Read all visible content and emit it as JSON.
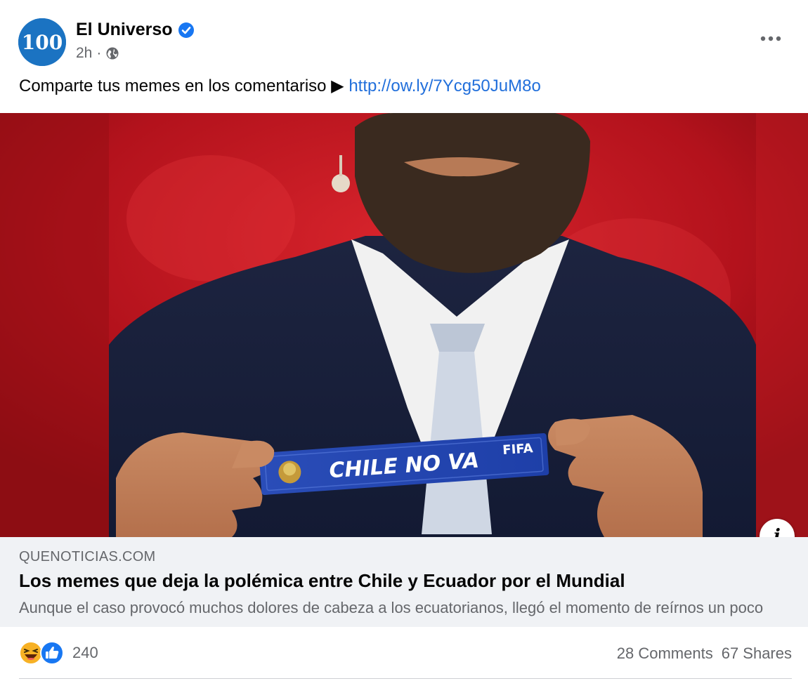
{
  "post": {
    "page_name": "El Universo",
    "avatar_text": "100",
    "time": "2h",
    "meta_separator": "·",
    "caption_text": "Comparte tus memes en los comentariso ▶ ",
    "caption_link": "http://ow.ly/7Ycg50JuM8o",
    "image": {
      "banner_text": "CHILE NO VA",
      "fifa_text": "FIFA"
    },
    "link_preview": {
      "domain": "QUENOTICIAS.COM",
      "title": "Los memes que deja la polémica entre Chile y Ecuador por el Mundial",
      "description": "Aunque el caso provocó muchos dolores de cabeza a los ecuatorianos, llegó el momento de reírnos un poco"
    },
    "info_icon": "i",
    "reaction_count": "240",
    "comments": "28 Comments",
    "shares": "67 Shares"
  },
  "colors": {
    "link": "#216fdb",
    "verified": "#1877f2",
    "brand_avatar": "#1b73c2",
    "secondary_text": "#65676b",
    "preview_bg": "#f0f2f5",
    "banner_blue": "#1e3fa8",
    "backdrop_red": "#b3121c"
  },
  "icons": [
    "verified-badge-icon",
    "globe-icon",
    "more-options-icon",
    "info-icon",
    "haha-reaction-icon",
    "like-reaction-icon"
  ]
}
